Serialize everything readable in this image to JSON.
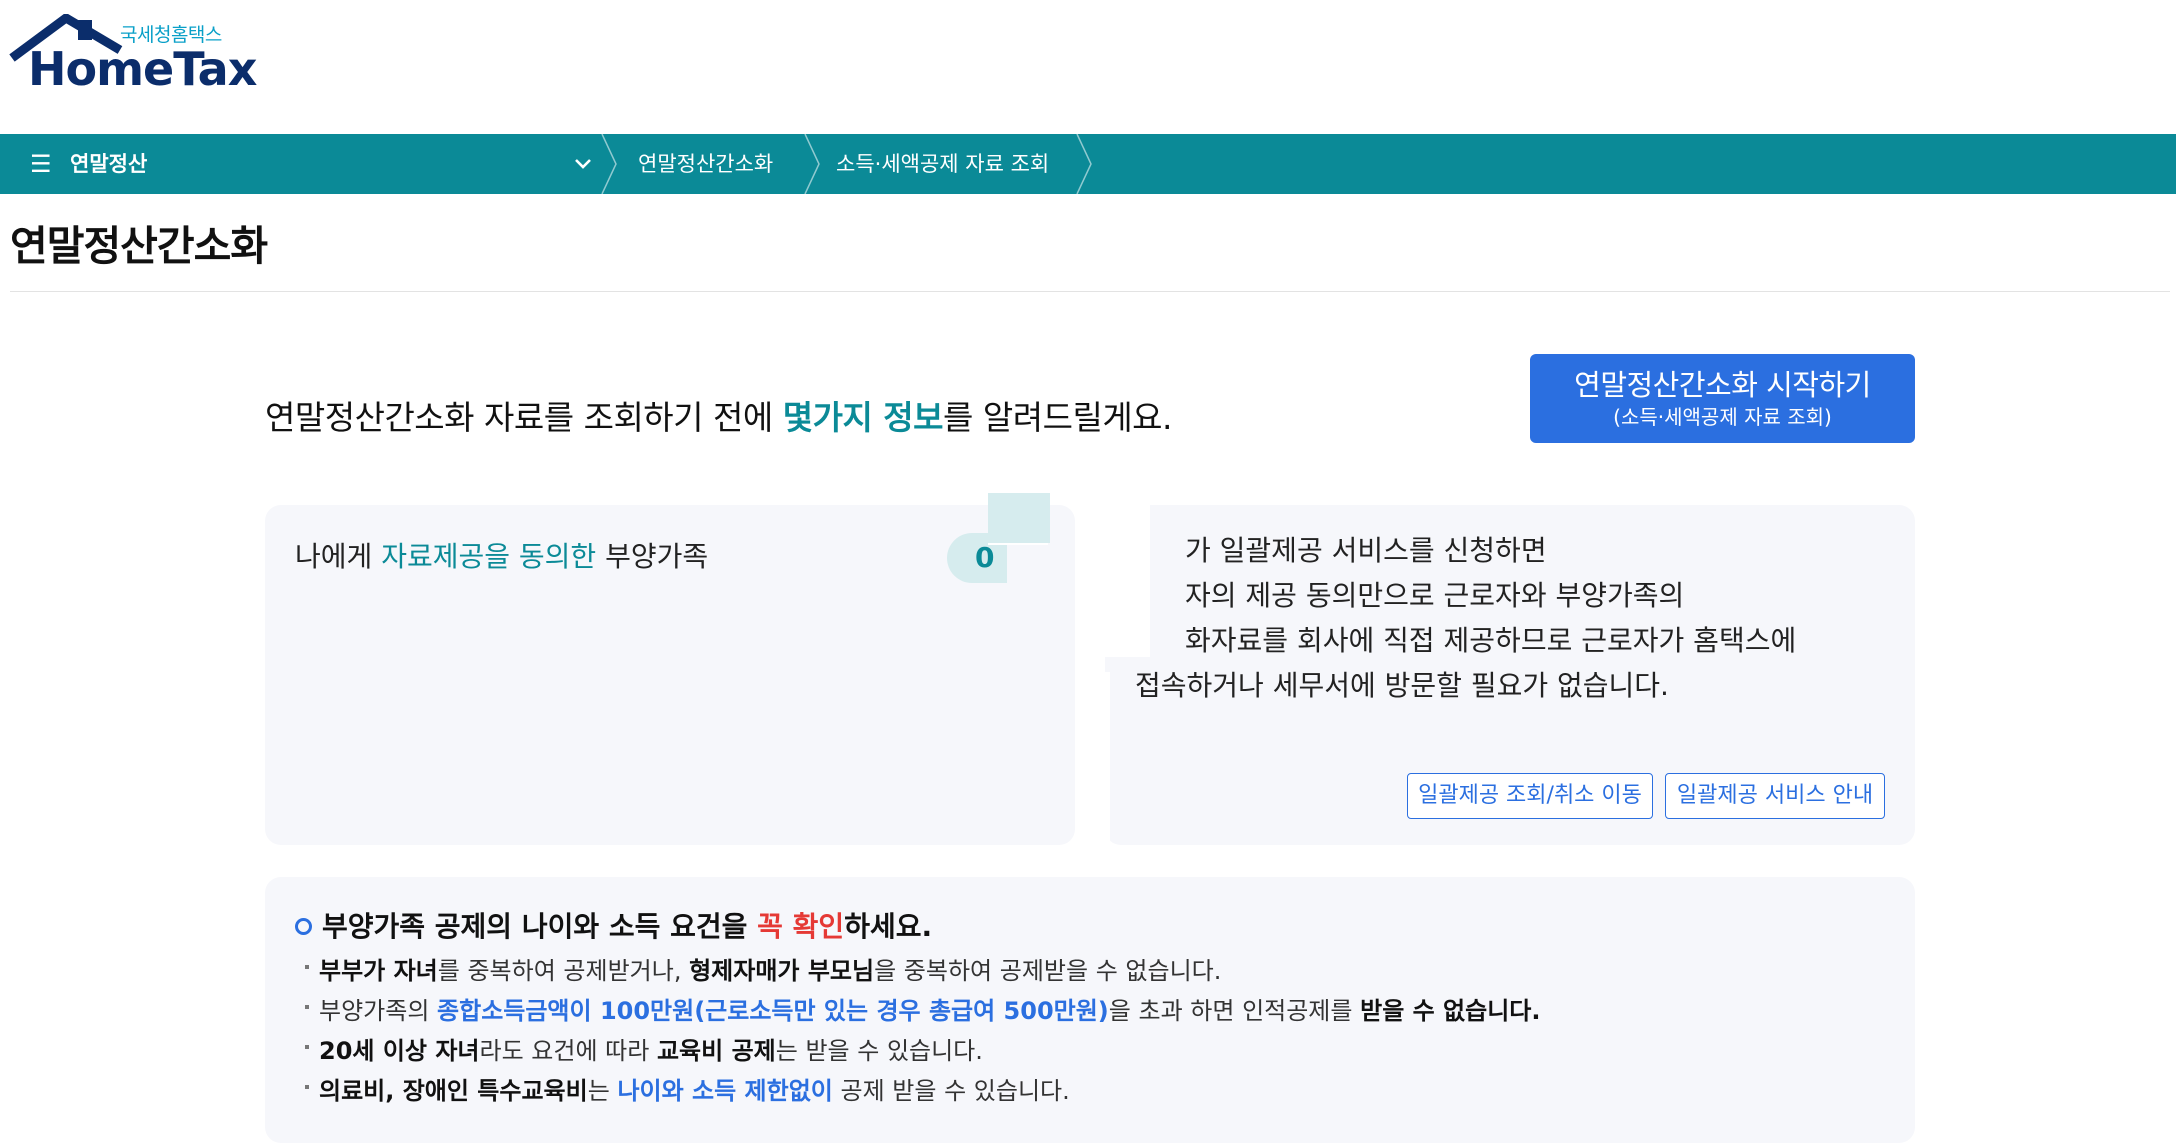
{
  "header": {
    "logo_sub": "국세청홈택스",
    "logo_main": "HomeTax"
  },
  "nav": {
    "menu_label": "연말정산",
    "crumbs": [
      "연말정산간소화",
      "소득·세액공제 자료 조회"
    ]
  },
  "page": {
    "title": "연말정산간소화"
  },
  "intro": {
    "pre": "연말정산간소화 자료를 조회하기 전에 ",
    "highlight": "몇가지 정보",
    "post": "를 알려드릴게요."
  },
  "start_button": {
    "line1": "연말정산간소화 시작하기",
    "line2": "(소득·세액공제 자료 조회)"
  },
  "consent_card": {
    "pre": "나에게 ",
    "highlight": "자료제공을 동의한",
    "post": " 부양가족",
    "count": "0"
  },
  "bulk_card": {
    "lines": [
      "가 일괄제공 서비스를 신청하면",
      "자의 제공 동의만으로 근로자와 부양가족의",
      "화자료를 회사에 직접 제공하므로 근로자가 홈택스에",
      "접속하거나 세무서에 방문할 필요가 없습니다."
    ],
    "buttons": [
      "일괄제공 조회/취소 이동",
      "일괄제공 서비스 안내"
    ]
  },
  "notice": {
    "head_pre": "부양가족 공제의 나이와 소득 요건을 ",
    "head_red": "꼭 확인",
    "head_post": "하세요.",
    "items": [
      [
        {
          "t": "부부가 자녀",
          "s": "b"
        },
        {
          "t": "를 중복하여 공제받거나, ",
          "s": ""
        },
        {
          "t": "형제자매가 부모님",
          "s": "b"
        },
        {
          "t": "을 중복하여 공제받을 수 없습니다.",
          "s": ""
        }
      ],
      [
        {
          "t": "부양가족의 ",
          "s": ""
        },
        {
          "t": "종합소득금액이 100만원(근로소득만 있는 경우 총급여 500만원)",
          "s": "blue"
        },
        {
          "t": "을 초과 하면 인적공제를 ",
          "s": ""
        },
        {
          "t": "받을 수 없습니다.",
          "s": "b"
        }
      ],
      [
        {
          "t": "20세 이상 자녀",
          "s": "b"
        },
        {
          "t": "라도 요건에 따라 ",
          "s": ""
        },
        {
          "t": "교육비 공제",
          "s": "b"
        },
        {
          "t": "는 받을 수 있습니다.",
          "s": ""
        }
      ],
      [
        {
          "t": "의료비, 장애인 특수교육비",
          "s": "b"
        },
        {
          "t": "는 ",
          "s": ""
        },
        {
          "t": "나이와 소득 제한없이",
          "s": "blue"
        },
        {
          "t": " 공제 받을 수 있습니다.",
          "s": ""
        }
      ]
    ]
  },
  "colors": {
    "nav_teal": "#0b8a97",
    "accent_blue": "#2b6fe0",
    "warning_red": "#e53935"
  }
}
